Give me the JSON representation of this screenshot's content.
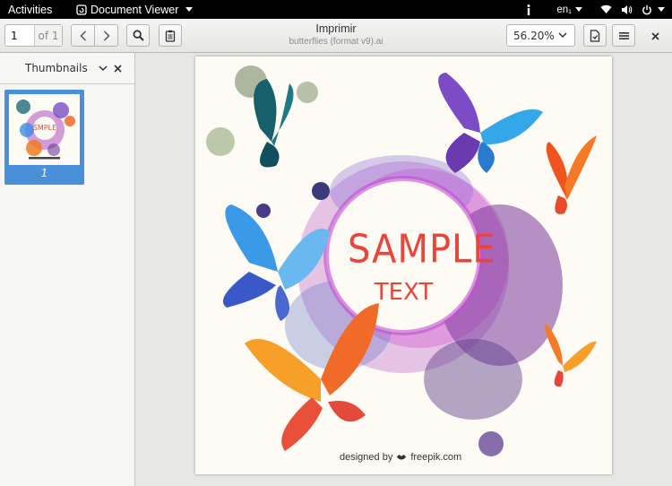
{
  "topbar": {
    "activities": "Activities",
    "app_name": "Document Viewer",
    "input_method": "en₁"
  },
  "toolbar": {
    "page_number": "1",
    "page_of": "of 1",
    "zoom": "56.20%"
  },
  "document": {
    "title": "Imprimir",
    "subtitle": "butterflies (format v9).ai"
  },
  "sidebar": {
    "mode_label": "Thumbnails",
    "thumbnail_page_label": "1"
  },
  "page_content": {
    "headline": "SAMPLE",
    "subline": "TEXT",
    "credit_prefix": "designed by",
    "credit_brand": "freepik.com"
  },
  "colors": {
    "accent": "#4a90d9",
    "headline_red": "#e8453c"
  }
}
